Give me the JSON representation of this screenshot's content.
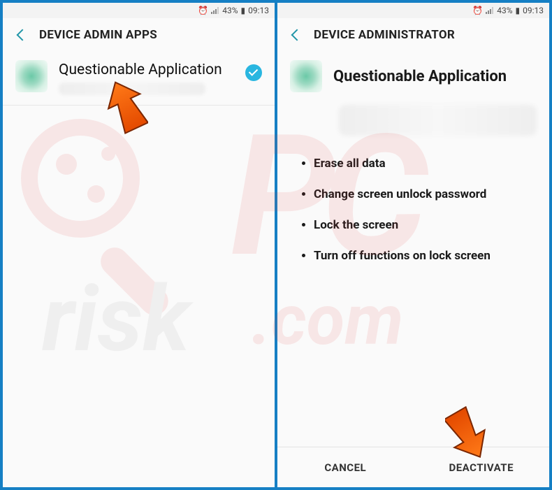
{
  "statusbar": {
    "battery_pct": "43%",
    "time": "09:13",
    "alarm_icon": "⏰",
    "battery_icon": "▮"
  },
  "left": {
    "title": "DEVICE ADMIN APPS",
    "app": {
      "name": "Questionable Application",
      "enabled": true
    }
  },
  "right": {
    "title": "DEVICE ADMINISTRATOR",
    "app": {
      "name": "Questionable Application"
    },
    "permissions": [
      "Erase all data",
      "Change screen unlock password",
      "Lock the screen",
      "Turn off functions on lock screen"
    ],
    "buttons": {
      "cancel": "CANCEL",
      "deactivate": "DEACTIVATE"
    }
  },
  "watermark": {
    "line1": "PC",
    "line2": "risk",
    "line3": ".com"
  }
}
